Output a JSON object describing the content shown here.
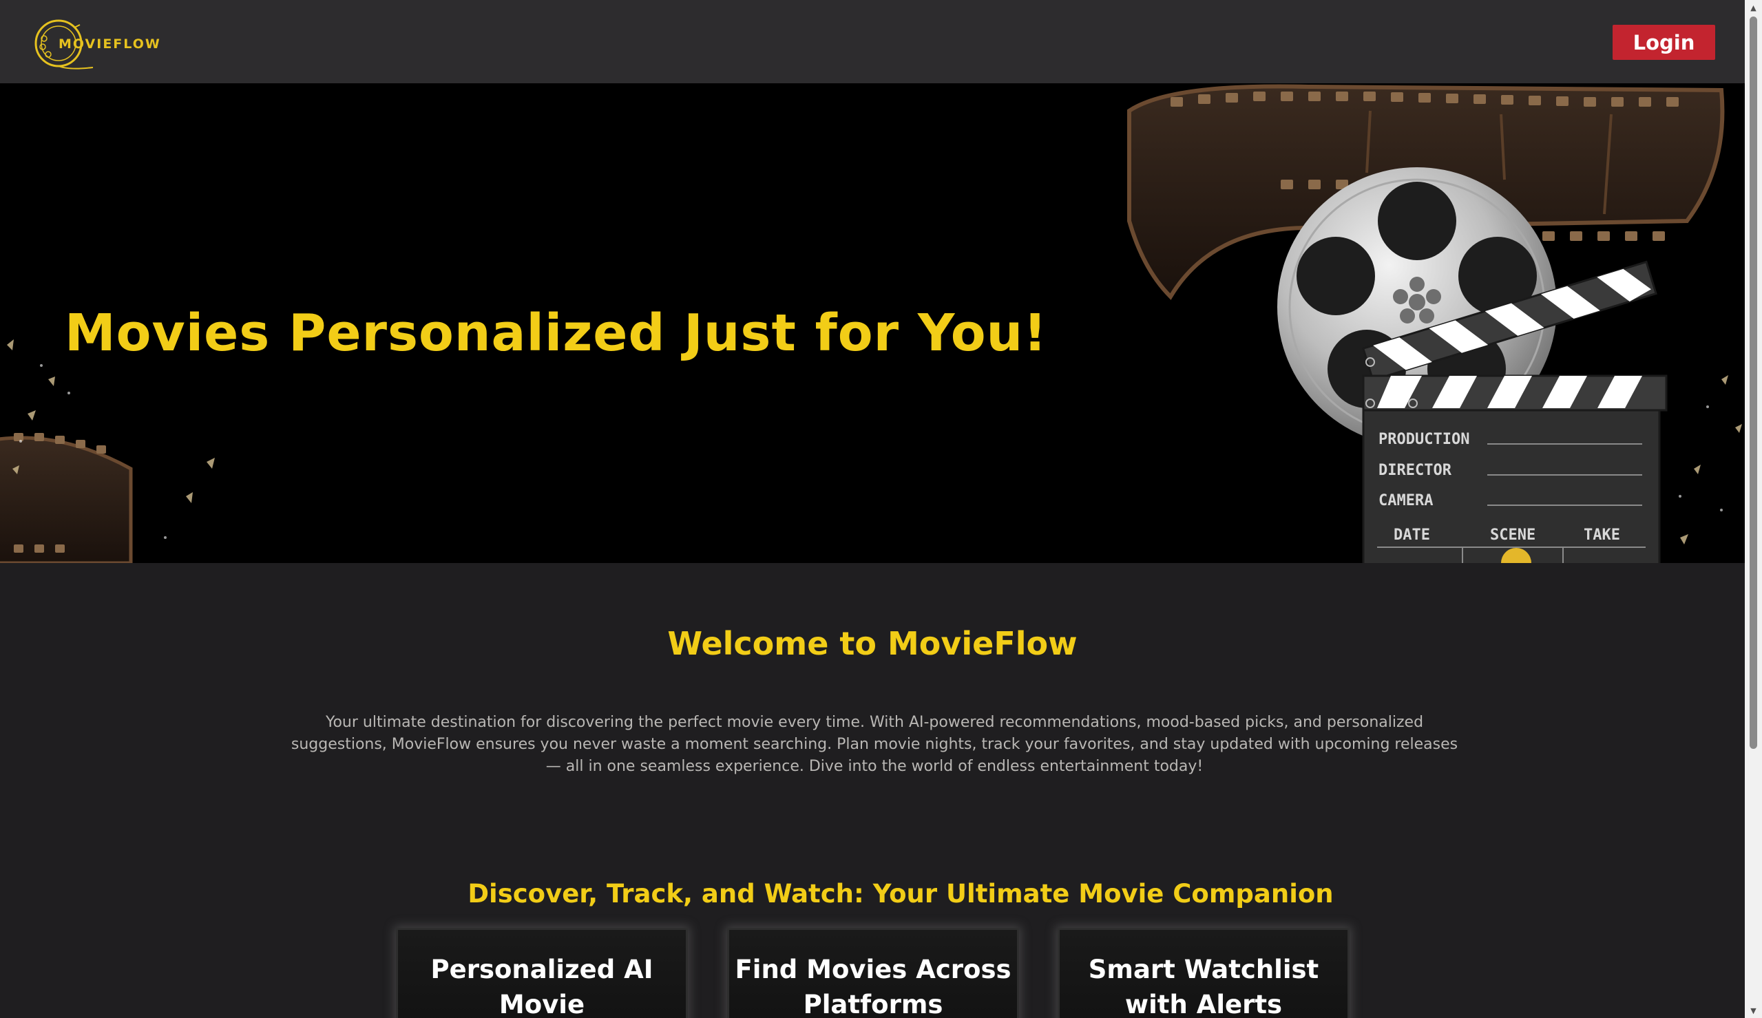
{
  "header": {
    "logo_text": "MOVIEFLOW",
    "login_label": "Login"
  },
  "hero": {
    "title": "Movies Personalized Just for You!",
    "clapper_labels": {
      "production": "PRODUCTION",
      "director": "DIRECTOR",
      "camera": "CAMERA",
      "date": "DATE",
      "scene": "SCENE",
      "take": "TAKE"
    }
  },
  "welcome": {
    "title": "Welcome to MovieFlow",
    "text": "Your ultimate destination for discovering the perfect movie every time. With AI-powered recommendations, mood-based picks, and personalized suggestions, MovieFlow ensures you never waste a moment searching. Plan movie nights, track your favorites, and stay updated with upcoming releases — all in one seamless experience. Dive into the world of endless entertainment today!"
  },
  "features": {
    "title": "Discover, Track, and Watch: Your Ultimate Movie Companion",
    "cards": [
      {
        "title": "Personalized AI Movie Recommendations"
      },
      {
        "title": "Find Movies Across Platforms"
      },
      {
        "title": "Smart Watchlist with Alerts"
      }
    ]
  },
  "colors": {
    "accent_yellow": "#f2cd17",
    "login_red": "#c3242f",
    "header_bg": "#2d2c2e",
    "page_bg": "#1f1e20"
  },
  "icons": {
    "logo": "film-reel-logo-icon",
    "hero_art": "film-reel-and-clapperboard-illustration"
  }
}
